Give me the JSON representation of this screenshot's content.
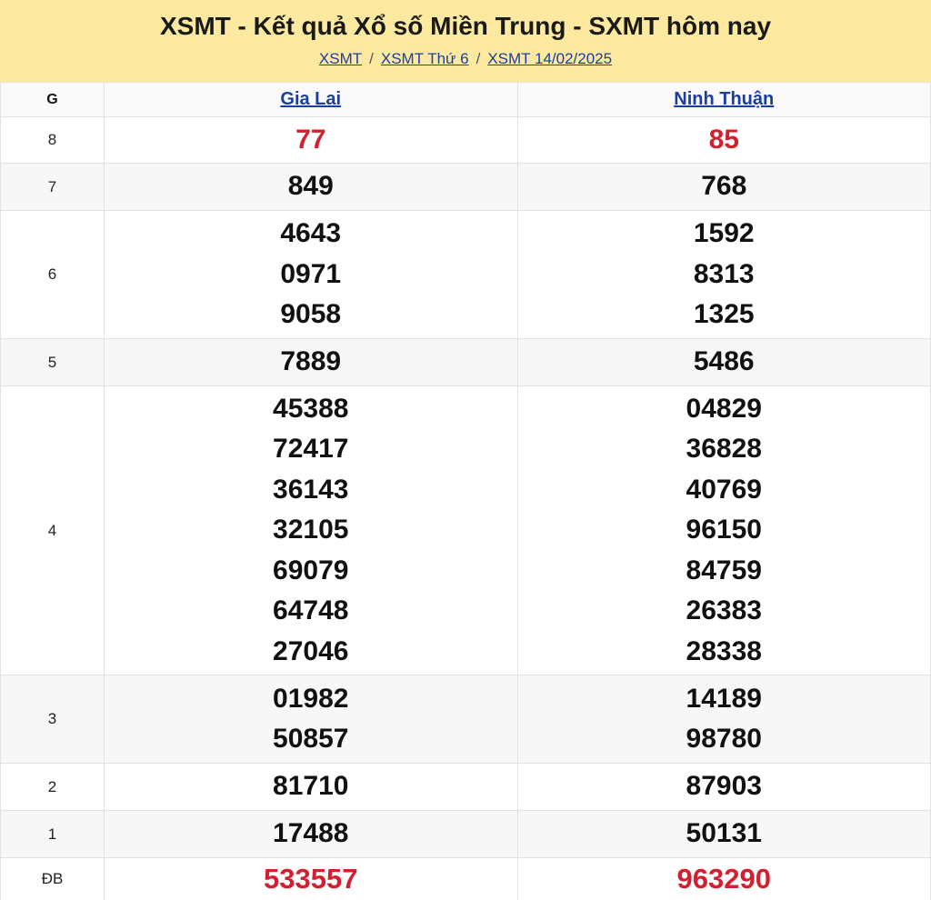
{
  "header": {
    "title": "XSMT - Kết quả Xổ số Miền Trung - SXMT hôm nay",
    "breadcrumb": [
      "XSMT",
      "XSMT Thứ 6",
      "XSMT 14/02/2025"
    ],
    "separator": "/",
    "background_color": "#fdeaa0"
  },
  "table": {
    "col_g_label": "G",
    "provinces": [
      "Gia Lai",
      "Ninh Thuận"
    ],
    "link_color": "#1b3fa0",
    "highlight_color": "#d3202f",
    "prizes": [
      {
        "label": "8",
        "gia_lai": [
          "77"
        ],
        "ninh_thuan": [
          "85"
        ]
      },
      {
        "label": "7",
        "gia_lai": [
          "849"
        ],
        "ninh_thuan": [
          "768"
        ]
      },
      {
        "label": "6",
        "gia_lai": [
          "4643",
          "0971",
          "9058"
        ],
        "ninh_thuan": [
          "1592",
          "8313",
          "1325"
        ]
      },
      {
        "label": "5",
        "gia_lai": [
          "7889"
        ],
        "ninh_thuan": [
          "5486"
        ]
      },
      {
        "label": "4",
        "gia_lai": [
          "45388",
          "72417",
          "36143",
          "32105",
          "69079",
          "64748",
          "27046"
        ],
        "ninh_thuan": [
          "04829",
          "36828",
          "40769",
          "96150",
          "84759",
          "26383",
          "28338"
        ]
      },
      {
        "label": "3",
        "gia_lai": [
          "01982",
          "50857"
        ],
        "ninh_thuan": [
          "14189",
          "98780"
        ]
      },
      {
        "label": "2",
        "gia_lai": [
          "81710"
        ],
        "ninh_thuan": [
          "87903"
        ]
      },
      {
        "label": "1",
        "gia_lai": [
          "17488"
        ],
        "ninh_thuan": [
          "50131"
        ]
      },
      {
        "label": "ĐB",
        "gia_lai": [
          "533557"
        ],
        "ninh_thuan": [
          "963290"
        ]
      }
    ]
  }
}
